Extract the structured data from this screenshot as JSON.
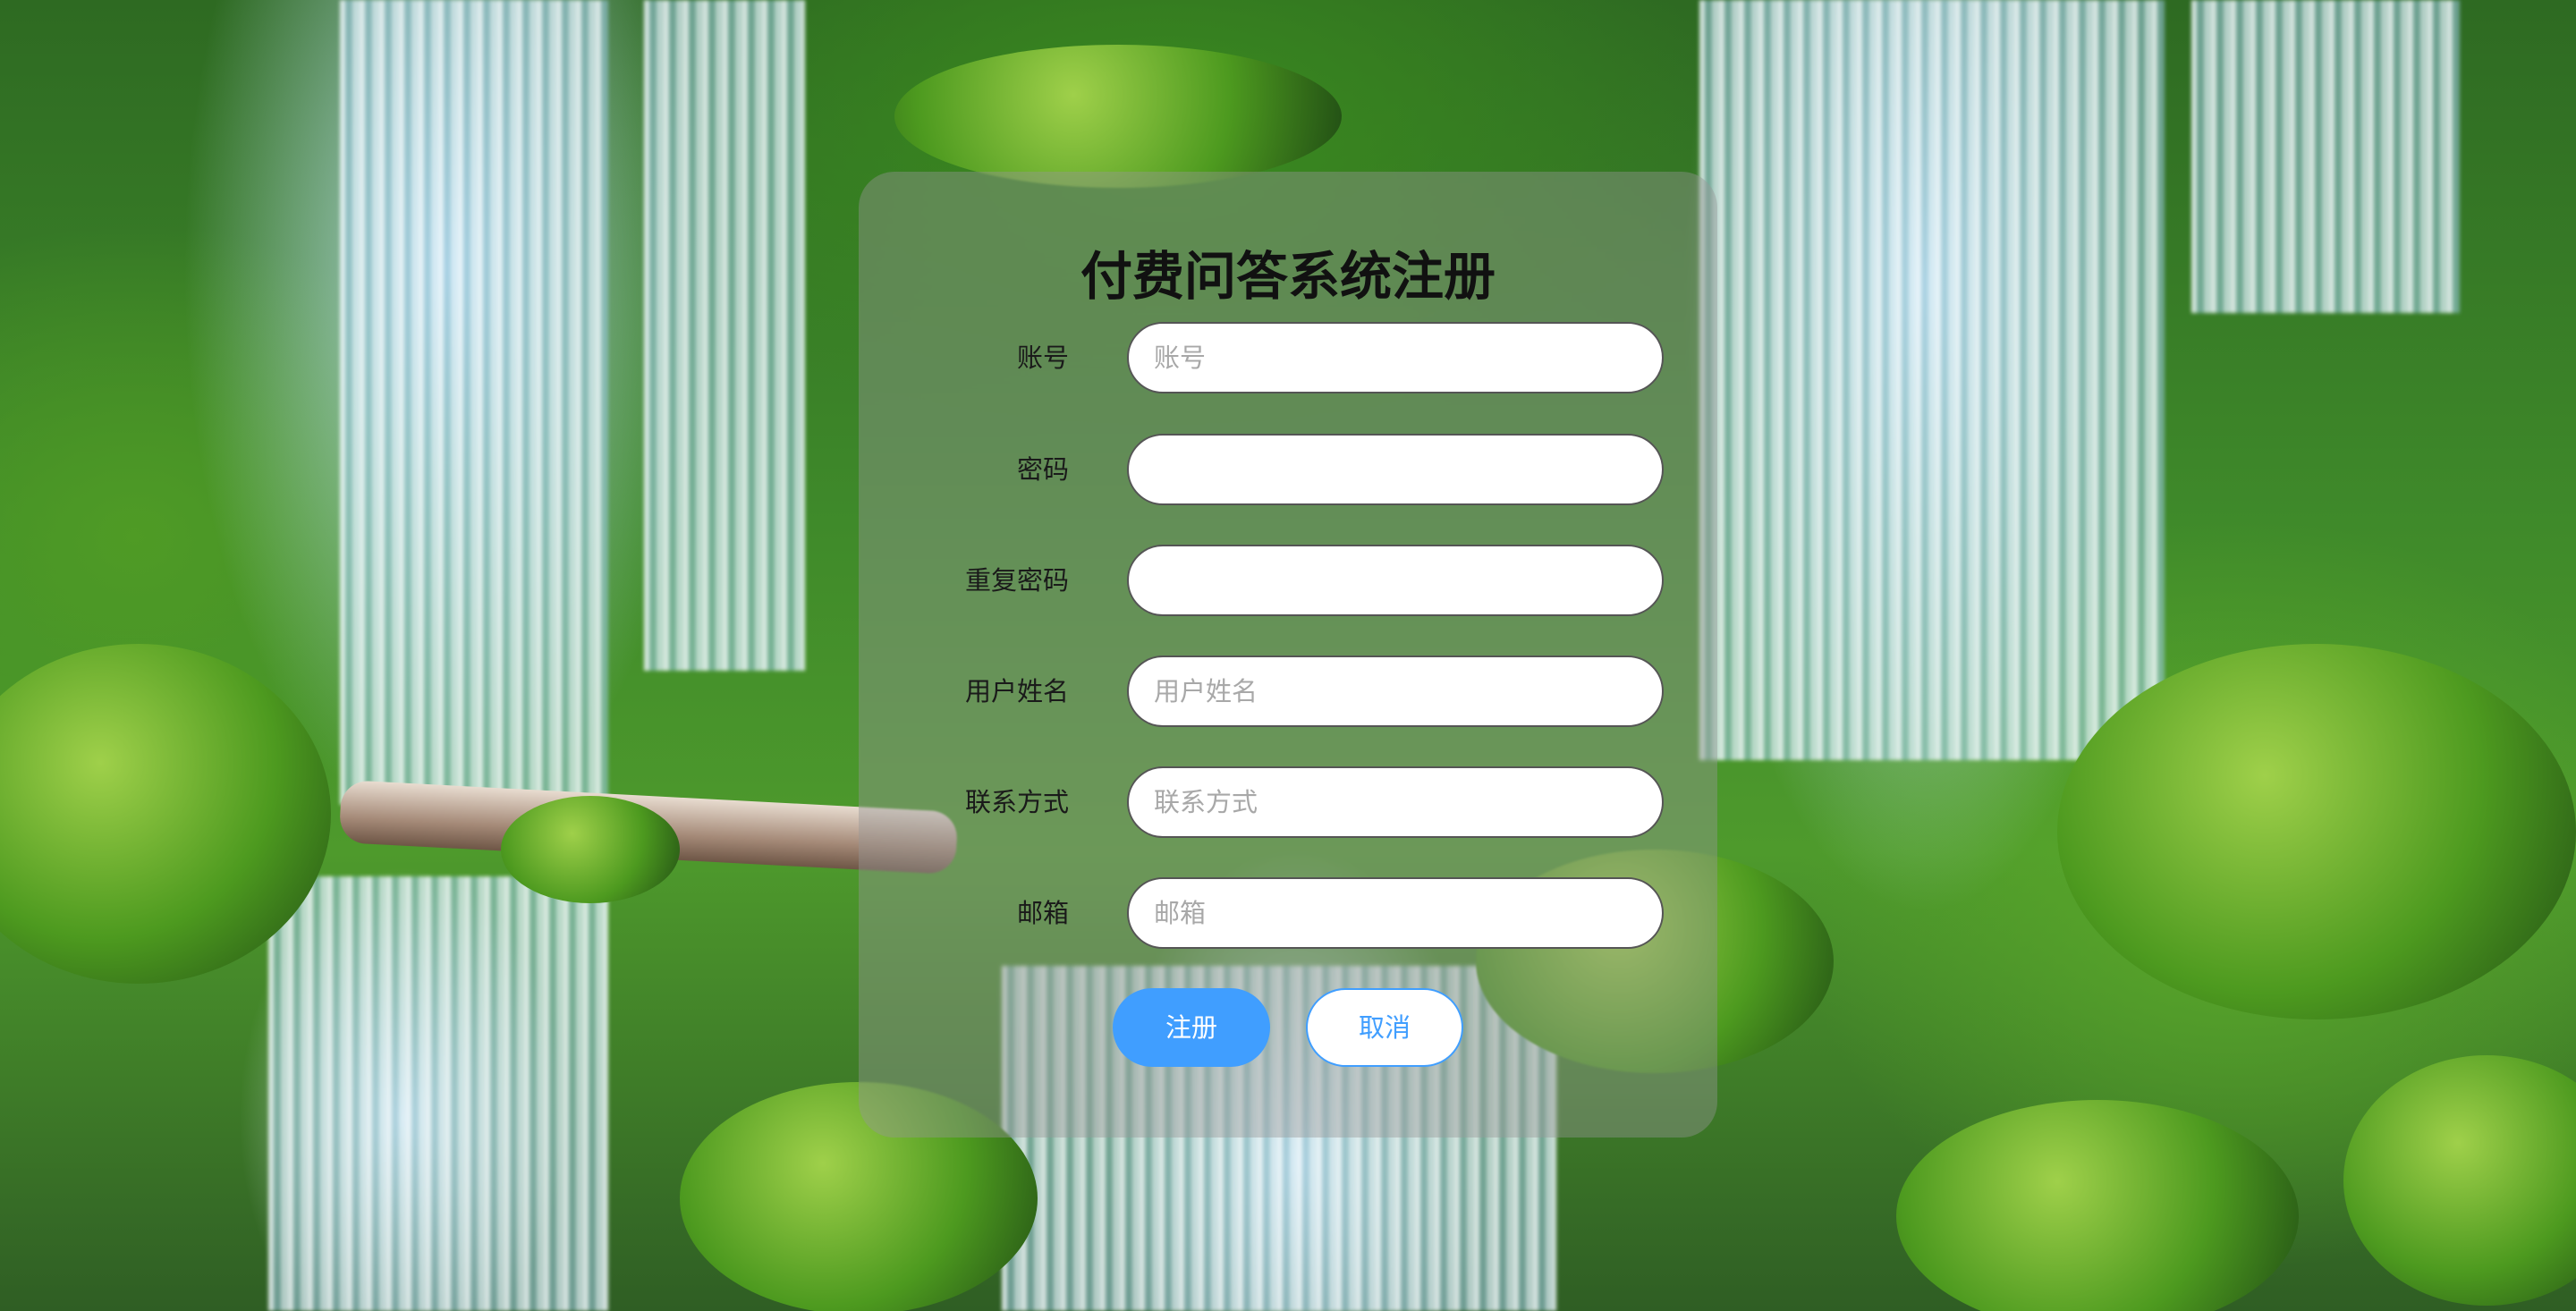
{
  "form": {
    "title": "付费问答系统注册",
    "fields": [
      {
        "label": "账号",
        "placeholder": "账号",
        "value": ""
      },
      {
        "label": "密码",
        "placeholder": "",
        "value": ""
      },
      {
        "label": "重复密码",
        "placeholder": "",
        "value": ""
      },
      {
        "label": "用户姓名",
        "placeholder": "用户姓名",
        "value": ""
      },
      {
        "label": "联系方式",
        "placeholder": "联系方式",
        "value": ""
      },
      {
        "label": "邮箱",
        "placeholder": "邮箱",
        "value": ""
      }
    ],
    "register_label": "注册",
    "cancel_label": "取消"
  },
  "colors": {
    "accent": "#409eff",
    "panel": "rgba(150,150,150,0.42)"
  }
}
